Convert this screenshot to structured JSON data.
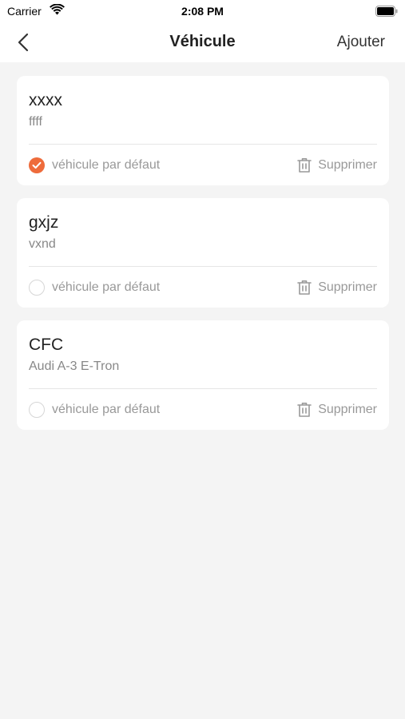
{
  "status_bar": {
    "carrier": "Carrier",
    "time": "2:08 PM"
  },
  "nav": {
    "title": "Véhicule",
    "add_label": "Ajouter"
  },
  "accent_color": "#ee6b3b",
  "vehicles": [
    {
      "plate": "xxxx",
      "model": "ffff",
      "default_label": "véhicule par défaut",
      "is_default": true,
      "delete_label": "Supprimer"
    },
    {
      "plate": "gxjz",
      "model": "vxnd",
      "default_label": "véhicule par défaut",
      "is_default": false,
      "delete_label": "Supprimer"
    },
    {
      "plate": "CFC",
      "model": "Audi A-3 E-Tron",
      "default_label": "véhicule par défaut",
      "is_default": false,
      "delete_label": "Supprimer"
    }
  ]
}
